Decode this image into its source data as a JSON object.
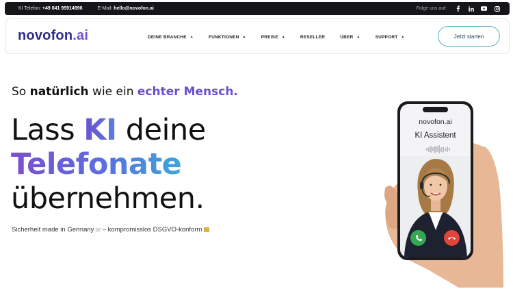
{
  "topbar": {
    "phone_label": "KI Telefon:",
    "phone_value": "+49 841 95914996",
    "email_label": "E-Mail:",
    "email_value": "hello@novofon.ai",
    "follow_label": "Folge uns auf:",
    "social_icons": [
      "facebook-icon",
      "linkedin-icon",
      "youtube-icon",
      "instagram-icon"
    ]
  },
  "header": {
    "logo_main": "novofon",
    "logo_suffix": ".ai",
    "nav": [
      {
        "label": "DEINE BRANCHE",
        "has_dropdown": true
      },
      {
        "label": "FUNKTIONEN",
        "has_dropdown": true
      },
      {
        "label": "PREISE",
        "has_dropdown": true
      },
      {
        "label": "RESELLER",
        "has_dropdown": false
      },
      {
        "label": "ÜBER",
        "has_dropdown": true
      },
      {
        "label": "SUPPORT",
        "has_dropdown": true
      }
    ],
    "cta": "Jetzt starten"
  },
  "hero": {
    "tagline_pre": "So ",
    "tagline_bold": "natürlich",
    "tagline_mid": " wie ein ",
    "tagline_accent": "echter Mensch.",
    "h1_line1_pre": "Lass ",
    "h1_line1_accent": "KI",
    "h1_line1_post": " deine",
    "h1_line2": "Telefonate",
    "h1_line3": "übernehmen.",
    "sub_pre": "Sicherheit made in Germany",
    "sub_flag": "DE",
    "sub_post": "– kompromisslos DSGVO-konform"
  },
  "phone": {
    "brand": "novofon.ai",
    "title": "KI Assistent"
  },
  "colors": {
    "brand": "#2f2c86",
    "accent_purple": "#6a4fc8",
    "accent_blue": "#3ea6d8",
    "cta_border": "#5ab0b8",
    "call_accept": "#34a853",
    "call_decline": "#e0453a"
  }
}
